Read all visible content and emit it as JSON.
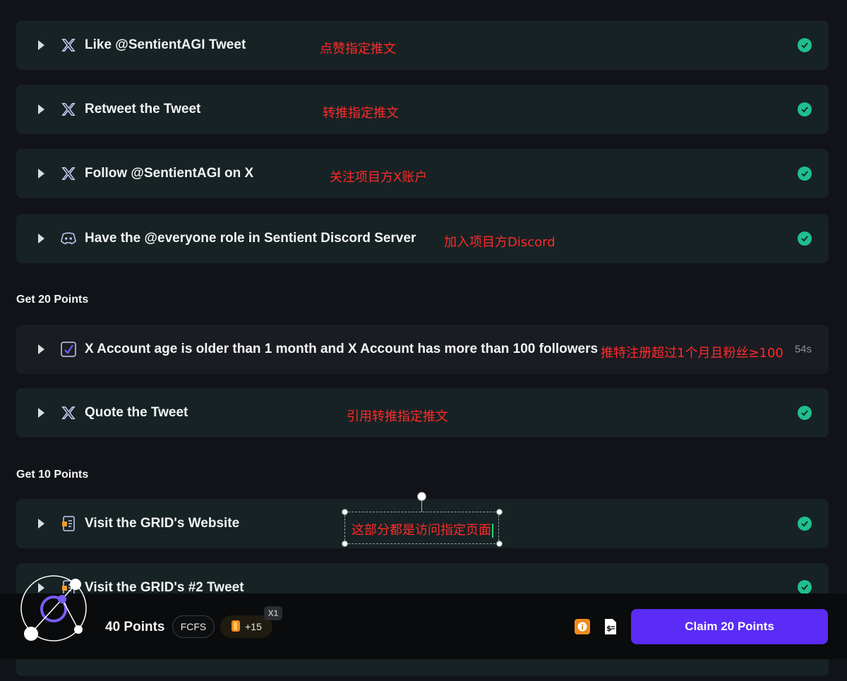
{
  "tasks_top": [
    {
      "icon": "x-logo-icon",
      "title": "Like @SentientAGI Tweet",
      "note": "点赞指定推文",
      "status": "done"
    },
    {
      "icon": "x-logo-icon",
      "title": "Retweet the Tweet",
      "note": "转推指定推文",
      "status": "done"
    },
    {
      "icon": "x-logo-icon",
      "title": "Follow @SentientAGI on X",
      "note": "关注项目方X账户",
      "status": "done"
    },
    {
      "icon": "discord-icon",
      "title": "Have the @everyone role in Sentient Discord Server",
      "note": "加入项目方Discord",
      "status": "done"
    }
  ],
  "section_20": {
    "heading": "Get 20 Points",
    "tasks": [
      {
        "icon": "account-check-icon",
        "title": "X Account age is older than 1 month and X Account has more than 100 followers",
        "note": "推特注册超过1个月且粉丝≥100",
        "timer": "54s"
      },
      {
        "icon": "x-logo-icon",
        "title": "Quote the Tweet",
        "note": "引用转推指定推文",
        "status": "done"
      }
    ]
  },
  "section_10": {
    "heading": "Get 10 Points",
    "tasks": [
      {
        "icon": "document-icon",
        "title": "Visit the GRID's Website",
        "status": "done"
      },
      {
        "icon": "document-icon",
        "title": "Visit the GRID's #2 Tweet",
        "status": "done"
      }
    ],
    "annotation": "这部分都是访问指定页面"
  },
  "bottom_bar": {
    "points": "40 Points",
    "fcfs": "FCFS",
    "bonus": "+15",
    "multiplier": "X1",
    "claim_label": "Claim 20 Points"
  },
  "colors": {
    "background": "#111318",
    "card": "#172224",
    "check": "#1fbf8f",
    "claim": "#5a2cf6",
    "note": "#ff2a2a"
  }
}
